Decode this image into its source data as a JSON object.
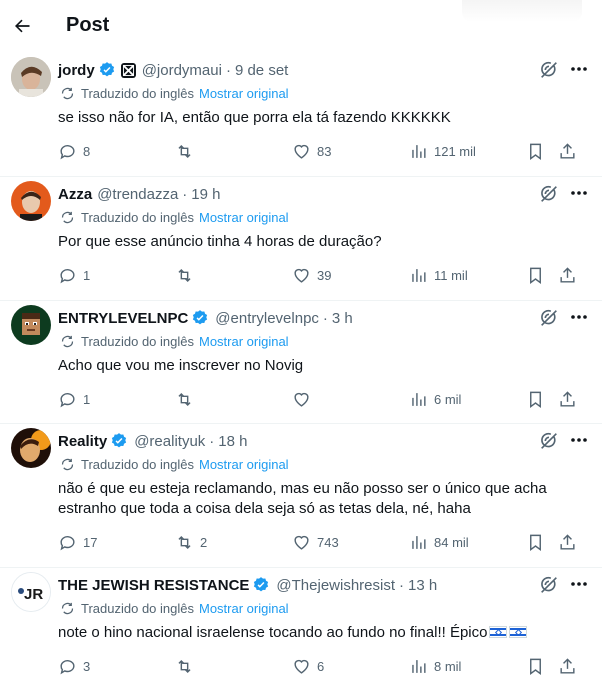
{
  "header": {
    "title": "Post",
    "back_icon": "arrow-left-icon"
  },
  "colors": {
    "accent": "#1d9bf0",
    "muted": "#536471",
    "text": "#0f1419"
  },
  "tweets": [
    {
      "name": "jordy",
      "verified": true,
      "affiliation_icon": "x-affiliate-icon",
      "handle": "@jordymaui",
      "dot": "·",
      "time": "9 de set",
      "translated_label": "Traduzido do inglês",
      "show_original": "Mostrar original",
      "text": "se isso não for IA, então que porra ela tá fazendo KKKKKK",
      "replies": "8",
      "retweets": "",
      "likes": "83",
      "views": "121 mil"
    },
    {
      "name": "Azza",
      "verified": false,
      "handle": "@trendazza",
      "dot": "·",
      "time": "19 h",
      "translated_label": "Traduzido do inglês",
      "show_original": "Mostrar original",
      "text": "Por que esse anúncio tinha 4 horas de duração?",
      "replies": "1",
      "retweets": "",
      "likes": "39",
      "views": "11 mil"
    },
    {
      "name": "ENTRYLEVELNPC",
      "verified": true,
      "handle": "@entrylevelnpc",
      "dot": "·",
      "time": "3 h",
      "translated_label": "Traduzido do inglês",
      "show_original": "Mostrar original",
      "text": "Acho que vou me inscrever no Novig",
      "replies": "1",
      "retweets": "",
      "likes": "",
      "views": "6 mil"
    },
    {
      "name": "Reality",
      "verified": true,
      "handle": "@realityuk",
      "dot": "·",
      "time": "18 h",
      "translated_label": "Traduzido do inglês",
      "show_original": "Mostrar original",
      "text": "não é que eu esteja reclamando, mas eu não posso ser o único que acha estranho que toda a coisa dela seja só as tetas dela, né, haha",
      "replies": "17",
      "retweets": "2",
      "likes": "743",
      "views": "84 mil"
    },
    {
      "name": "THE JEWISH RESISTANCE",
      "verified": true,
      "handle": "@Thejewishresist",
      "dot": "·",
      "time": "13 h",
      "translated_label": "Traduzido do inglês",
      "show_original": "Mostrar original",
      "text": "note o hino nacional israelense tocando ao fundo no final!! Épico",
      "text_emoji": "israel-flag-icon",
      "replies": "3",
      "retweets": "",
      "likes": "6",
      "views": "8 mil"
    }
  ],
  "avatars": {
    "t4_initials": "JR"
  }
}
